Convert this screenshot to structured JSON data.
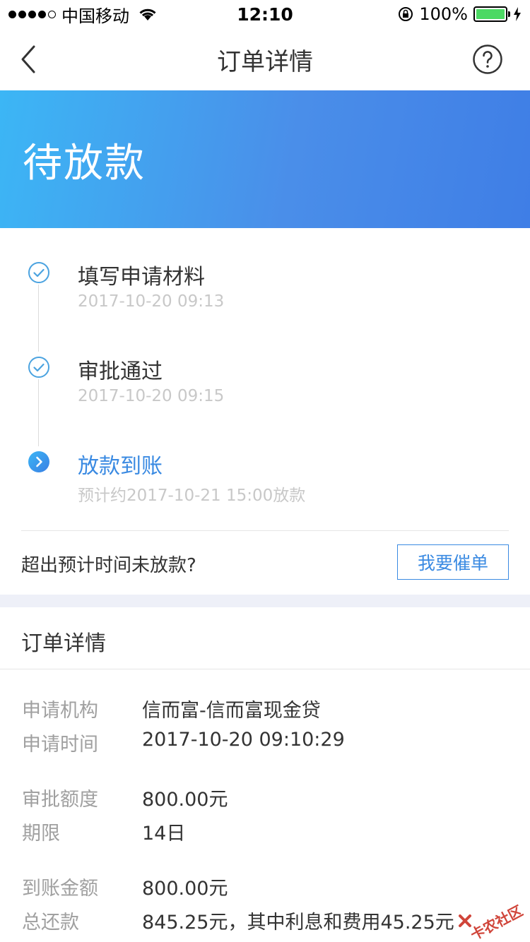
{
  "status_bar": {
    "carrier": "中国移动",
    "time": "12:10",
    "battery": "100%",
    "signal_bars": 4
  },
  "nav": {
    "title": "订单详情",
    "back_icon": "chevron-left-icon",
    "help_icon": "question-circle-icon"
  },
  "banner": {
    "status": "待放款",
    "gradient_start": "#3cb6f5",
    "gradient_end": "#3f7ee6"
  },
  "timeline": {
    "steps": [
      {
        "title": "填写申请材料",
        "time": "2017-10-20 09:13",
        "state": "done",
        "icon": "check-circle-icon"
      },
      {
        "title": "审批通过",
        "time": "2017-10-20 09:15",
        "state": "done",
        "icon": "check-circle-icon"
      },
      {
        "title": "放款到账",
        "time": "预计约2017-10-21 15:00放款",
        "state": "active",
        "icon": "chevron-right-circle-icon"
      }
    ]
  },
  "urge": {
    "prompt": "超出预计时间未放款?",
    "button_label": "我要催单"
  },
  "details": {
    "section_title": "订单详情",
    "rows": [
      {
        "label": "申请机构",
        "value": "信而富-信而富现金贷"
      },
      {
        "label": "申请时间",
        "value": "2017-10-20 09:10:29"
      },
      {
        "label": "审批额度",
        "value": "800.00元"
      },
      {
        "label": "期限",
        "value": "14日"
      },
      {
        "label": "到账金额",
        "value": "800.00元"
      },
      {
        "label": "总还款",
        "value": "845.25元，其中利息和费用45.25元"
      }
    ]
  },
  "watermark": {
    "text": "卡农社区"
  },
  "colors": {
    "accent": "#3a8ae2",
    "muted_text": "#c8c8c8",
    "label_text": "#a0a0a0",
    "gap_band": "#eef0f8"
  }
}
